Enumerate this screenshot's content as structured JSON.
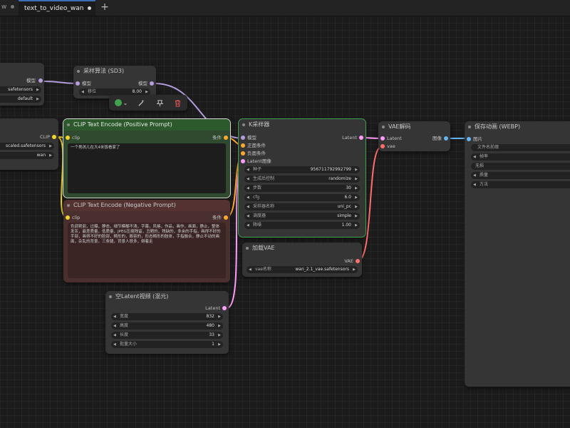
{
  "tabs": [
    {
      "label": "w"
    },
    {
      "label": "text_to_video_wan"
    }
  ],
  "new_tab_label": "+",
  "toolbar": {
    "color_label": "●",
    "chevron": "⌄",
    "wand": "⚲",
    "pin": "⚲",
    "delete": "🗑"
  },
  "nodes": {
    "loader_partial": {
      "output_label": "模型",
      "widgets": [
        {
          "value": "safetensors"
        },
        {
          "value": "default"
        }
      ]
    },
    "sampling_algo": {
      "title": "采样算法 (SD3)",
      "input_label": "模型",
      "output_label": "模型",
      "widget": {
        "label": "移位",
        "value": "8.00"
      }
    },
    "clip_loader": {
      "output_label": "CLIP",
      "widgets": [
        {
          "value": "scaled.safetensors"
        },
        {
          "value": "wan"
        }
      ]
    },
    "clip_positive": {
      "title": "CLIP Text Encode (Positive Prompt)",
      "input_label": "clip",
      "output_label": "条件",
      "text": "一个男孩儿在大4米饭看家了"
    },
    "clip_negative": {
      "title": "CLIP Text Encode (Negative Prompt)",
      "input_label": "clip",
      "output_label": "条件",
      "text": "色调艳丽，过曝，静态，细节模糊不清，字幕，风格，作品，画作，画面，静止，整体发灰，最差质量，低质量，JPEG压缩残留，丑陋的，残缺的，多余的手指，画得不好的手部，画得不好的脸部，畸形的，毁容的，形态畸形的肢体，手指融合，静止不动的画面，杂乱的背景，三条腿，背景人很多，倒着走"
    },
    "ksampler": {
      "title": "K采样器",
      "inputs": [
        "模型",
        "正面条件",
        "负面条件",
        "Latent图像"
      ],
      "output_label": "Latent",
      "widgets": [
        {
          "label": "种子",
          "value": "956711792992799"
        },
        {
          "label": "生成后控制",
          "value": "randomize"
        },
        {
          "label": "步数",
          "value": "30"
        },
        {
          "label": "cfg",
          "value": "6.0"
        },
        {
          "label": "采样器名称",
          "value": "uni_pc"
        },
        {
          "label": "调度器",
          "value": "simple"
        },
        {
          "label": "降噪",
          "value": "1.00"
        }
      ]
    },
    "vae_decode": {
      "title": "VAE解码",
      "inputs": [
        "Latent",
        "vae"
      ],
      "output_label": "图像"
    },
    "vae_loader": {
      "title": "加载VAE",
      "output_label": "VAE",
      "widget": {
        "label": "vae名称",
        "value": "wan_2.1_vae.safetensors"
      }
    },
    "empty_latent": {
      "title": "空Latent视频 (混元)",
      "output_label": "Latent",
      "widgets": [
        {
          "label": "宽度",
          "value": "832"
        },
        {
          "label": "高度",
          "value": "480"
        },
        {
          "label": "长度",
          "value": "33"
        },
        {
          "label": "批量大小",
          "value": "1"
        }
      ]
    },
    "save_anim": {
      "title": "保存动画 (WEBP)",
      "input_label": "图片",
      "widgets": [
        {
          "label": "文件名前缀"
        },
        {
          "label": "帧率"
        },
        {
          "label": "无损"
        },
        {
          "label": "质量"
        },
        {
          "label": "方法"
        }
      ]
    }
  },
  "colors": {
    "canvas": "#1b1b1b",
    "node_body": "#353535",
    "positive_node": "#2f4f2f",
    "negative_node": "#4f2f2f",
    "selected_outline": "#3fa34d",
    "clip_wire": "#f2d52a",
    "cond_wire": "#ffa931",
    "model_wire": "#b39ddb",
    "latent_wire": "#ff9cf9",
    "vae_wire": "#ff6e6e",
    "image_wire": "#64b5f6"
  }
}
